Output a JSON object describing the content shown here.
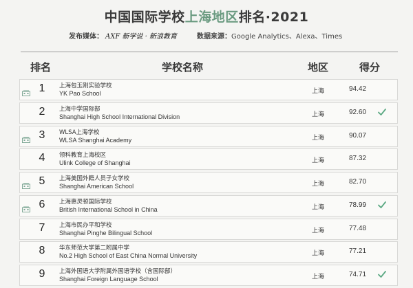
{
  "title": {
    "part1": "中国国际学校",
    "part2": "上海地区",
    "part3": "排名·2021"
  },
  "meta": {
    "publisher_label": "发布媒体：",
    "publisher_sig": "AXF 新学说 · 新浪教育",
    "source_label": "数据来源：",
    "source_value": "Google Analytics、Alexa、Times"
  },
  "header": {
    "rank": "排名",
    "name": "学校名称",
    "region": "地区",
    "score": "得分"
  },
  "colors": {
    "highlight": "#6a9a80",
    "check": "#5aa882",
    "icon": "#7fa896"
  },
  "rows": [
    {
      "rank": "1",
      "cn": "上海包玉刚实验学校",
      "en": "YK Pao School",
      "region": "上海",
      "score": "94.42",
      "icon": true,
      "check": false
    },
    {
      "rank": "2",
      "cn": "上海中学国际部",
      "en": "Shanghai High School International Division",
      "region": "上海",
      "score": "92.60",
      "icon": false,
      "check": true
    },
    {
      "rank": "3",
      "cn": "WLSA上海学校",
      "en": "WLSA Shanghai Academy",
      "region": "上海",
      "score": "90.07",
      "icon": true,
      "check": false
    },
    {
      "rank": "4",
      "cn": "领科教育上海校区",
      "en": "Ulink College of Shanghai",
      "region": "上海",
      "score": "87.32",
      "icon": false,
      "check": false
    },
    {
      "rank": "5",
      "cn": "上海美国外籍人员子女学校",
      "en": "Shanghai American School",
      "region": "上海",
      "score": "82.70",
      "icon": true,
      "check": false
    },
    {
      "rank": "6",
      "cn": "上海惠灵顿国际学校",
      "en": "British International School in China",
      "region": "上海",
      "score": "78.99",
      "icon": true,
      "check": true
    },
    {
      "rank": "7",
      "cn": "上海市民办平和学校",
      "en": "Shanghai Pinghe Bilingual School",
      "region": "上海",
      "score": "77.48",
      "icon": false,
      "check": false
    },
    {
      "rank": "8",
      "cn": "华东师范大学第二附属中学",
      "en": "No.2 High School of East China Normal University",
      "region": "上海",
      "score": "77.21",
      "icon": false,
      "check": false
    },
    {
      "rank": "9",
      "cn": "上海外国语大学附属外国语学校（含国际部）",
      "en": "Shanghai Foreign Language School",
      "region": "上海",
      "score": "74.71",
      "icon": false,
      "check": true
    }
  ]
}
